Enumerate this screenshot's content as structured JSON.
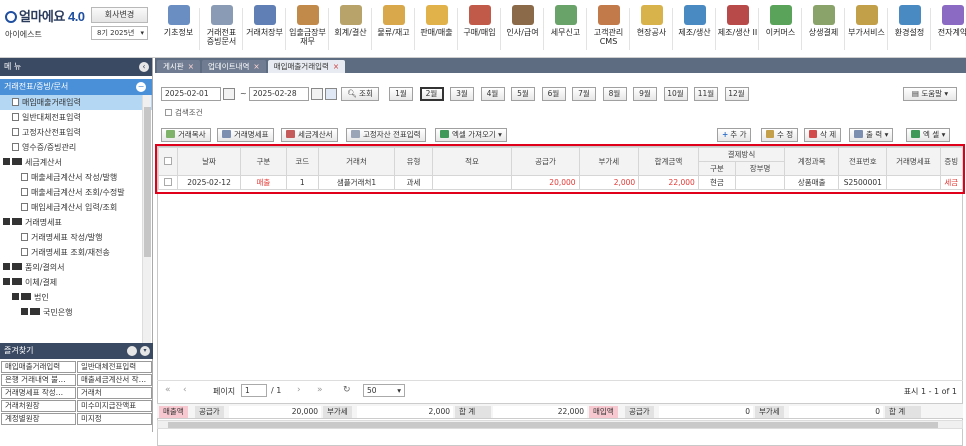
{
  "header": {
    "logo_text": "얼마에요",
    "logo_version": "4.0",
    "company_change": "회사변경",
    "user": "아이에스트",
    "period": "8기 2025년"
  },
  "menus": [
    {
      "label": "기초정보",
      "icon": "basic-info-icon",
      "color": "#6b8ec2"
    },
    {
      "label": "거래전표\n증빙문서",
      "icon": "voucher-icon",
      "color": "#8a9bb5"
    },
    {
      "label": "거래처장부",
      "icon": "ledger-icon",
      "color": "#5f7fb5"
    },
    {
      "label": "입출금장부\n재무",
      "icon": "cashbook-icon",
      "color": "#c28a4a"
    },
    {
      "label": "회계/결산",
      "icon": "accounting-icon",
      "color": "#b8a36a"
    },
    {
      "label": "물류/재고",
      "icon": "logistics-icon",
      "color": "#d8a84a"
    },
    {
      "label": "판매/매출",
      "icon": "sales-icon",
      "color": "#e2b24a"
    },
    {
      "label": "구매/매입",
      "icon": "purchase-icon",
      "color": "#c25a4a"
    },
    {
      "label": "인사/급여",
      "icon": "hr-icon",
      "color": "#8b6a4a"
    },
    {
      "label": "세무신고",
      "icon": "tax-icon",
      "color": "#6aa36a"
    },
    {
      "label": "고객관리\nCMS",
      "icon": "cms-icon",
      "color": "#c27a4a"
    },
    {
      "label": "현장공사",
      "icon": "construction-icon",
      "color": "#d8b24a"
    },
    {
      "label": "제조/생산",
      "icon": "manufacture-icon",
      "color": "#4a8ac2"
    },
    {
      "label": "제조/생산 II",
      "icon": "factory-icon",
      "color": "#b84a4a"
    },
    {
      "label": "이커머스",
      "icon": "ecommerce-icon",
      "color": "#5aa35a"
    },
    {
      "label": "상생결제",
      "icon": "payment-icon",
      "color": "#8aa36a"
    },
    {
      "label": "부가서비스",
      "icon": "service-icon",
      "color": "#c2a04a"
    },
    {
      "label": "환경설정",
      "icon": "settings-icon",
      "color": "#4a8ac2"
    },
    {
      "label": "전자계약",
      "icon": "contract-icon",
      "color": "#8a6ac2"
    }
  ],
  "sidebar": {
    "title": "메 뉴",
    "tree_top": "거래전표/증빙/문서",
    "items": [
      {
        "label": "매입매출거래입력",
        "type": "doc",
        "indent": 1,
        "selected": true
      },
      {
        "label": "일반대체전표입력",
        "type": "doc",
        "indent": 1
      },
      {
        "label": "고정자산전표입력",
        "type": "doc",
        "indent": 1
      },
      {
        "label": "영수증/증빙관리",
        "type": "doc",
        "indent": 1
      },
      {
        "label": "세금계산서",
        "type": "folder",
        "indent": 0
      },
      {
        "label": "매출세금계산서 작성/발행",
        "type": "doc",
        "indent": 2
      },
      {
        "label": "매출세금계산서 조회/수정발",
        "type": "doc",
        "indent": 2
      },
      {
        "label": "매입세금계산서 입력/조회",
        "type": "doc",
        "indent": 2
      },
      {
        "label": "거래명세표",
        "type": "folder",
        "indent": 0
      },
      {
        "label": "거래명세표 작성/발행",
        "type": "doc",
        "indent": 2
      },
      {
        "label": "거래명세표 조회/재전송",
        "type": "doc",
        "indent": 2
      },
      {
        "label": "품의/결의서",
        "type": "folder",
        "indent": 0
      },
      {
        "label": "이체/결제",
        "type": "folder",
        "indent": 0
      },
      {
        "label": "법인",
        "type": "folder",
        "indent": 1
      },
      {
        "label": "국민은행",
        "type": "folder",
        "indent": 2
      }
    ]
  },
  "favorites": {
    "title": "즐겨찾기",
    "items": [
      "매입매출거래입력",
      "일반대체전표입력",
      "은행 거래내역 불…",
      "매출세금계산서 작…",
      "거래명세표 작성…",
      "거래처",
      "거래처원장",
      "미수미지급잔액표",
      "계정별원장",
      "미지정"
    ]
  },
  "tabs": [
    {
      "label": "게시판"
    },
    {
      "label": "업데이트내역"
    },
    {
      "label": "매입매출거래입력",
      "active": true
    }
  ],
  "filter": {
    "date_from": "2025-02-01",
    "tilde": "~",
    "date_to": "2025-02-28",
    "search": "조회",
    "months": [
      "1월",
      "2월",
      "3월",
      "4월",
      "5월",
      "6월",
      "7월",
      "8월",
      "9월",
      "10월",
      "11월",
      "12월"
    ],
    "active_month": "2월",
    "help": "도움말",
    "search_condition": "검색조건"
  },
  "toolbar": {
    "copy": "거래복사",
    "statement": "거래명세표",
    "tax_invoice": "세금계산서",
    "asset_voucher": "고정자산 전표입력",
    "excel_import": "엑셀 가져오기",
    "add": "추 가",
    "edit": "수 정",
    "delete": "삭 제",
    "print": "출 력",
    "excel": "엑 셀"
  },
  "grid": {
    "headers": [
      "날짜",
      "구분",
      "코드",
      "거래처",
      "유형",
      "적요",
      "공급가",
      "부가세",
      "합계금액",
      "결제방식",
      "계정과목",
      "전표번호",
      "거래명세표",
      "증빙"
    ],
    "subheaders": [
      "구분",
      "장부명"
    ],
    "rows": [
      {
        "date": "2025-02-12",
        "kind": "매출",
        "code": "1",
        "client": "샘플거래처1",
        "type": "과세",
        "memo": "",
        "supply": "20,000",
        "vat": "2,000",
        "total": "22,000",
        "pay_kind": "현금",
        "book": "",
        "account": "상품매출",
        "voucher_no": "S2500001",
        "statement": "",
        "proof": "세금"
      }
    ]
  },
  "pager": {
    "page_label": "페이지",
    "page": "1",
    "of": "/ 1",
    "page_size": "50",
    "display": "표시 1 - 1 of 1"
  },
  "summary": {
    "sales_label": "매출액",
    "supply_label": "공급가",
    "supply": "20,000",
    "vat_label": "부가세",
    "vat": "2,000",
    "total_label": "합 계",
    "total": "22,000",
    "purchase_label": "매입액",
    "p_supply_label": "공급가",
    "p_supply": "0",
    "p_vat_label": "부가세",
    "p_vat": "0",
    "p_total_label": "합 계"
  }
}
